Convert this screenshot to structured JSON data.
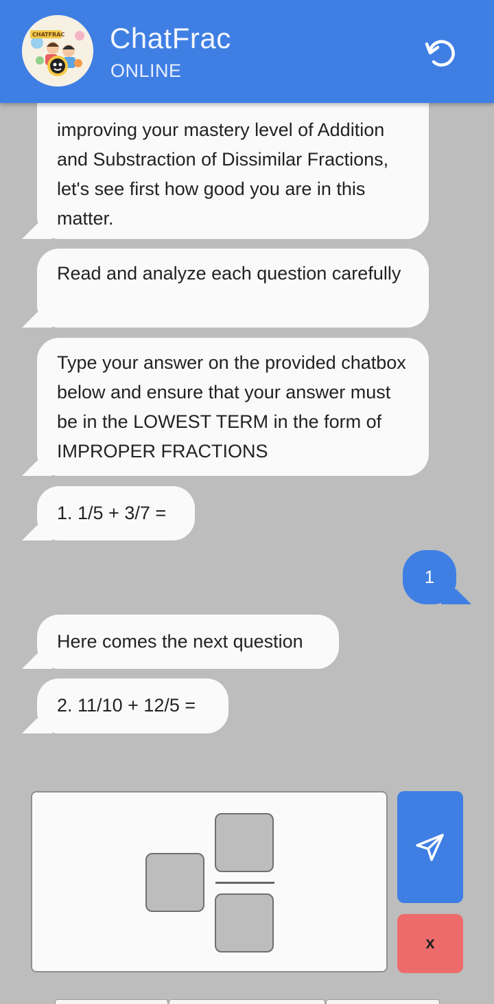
{
  "header": {
    "title": "ChatFrac",
    "status": "ONLINE",
    "logo_text": "CHATFRAC"
  },
  "messages": [
    {
      "sender": "bot",
      "text": "improving your mastery level of Addition and Substraction of Dissimilar Fractions, let's see first how good you are in this matter."
    },
    {
      "sender": "bot",
      "text": "Read and analyze each question carefully"
    },
    {
      "sender": "bot",
      "text": "Type your answer on the provided chatbox below and ensure that your answer must be in the LOWEST TERM in the form of IMPROPER FRACTIONS"
    },
    {
      "sender": "bot",
      "text": "1. 1/5 + 3/7 ="
    },
    {
      "sender": "user",
      "text": "1"
    },
    {
      "sender": "bot",
      "text": "Here comes the next question"
    },
    {
      "sender": "bot",
      "text": "2. 11/10 + 12/5 ="
    }
  ],
  "answer_input": {
    "whole": "",
    "numerator": "",
    "denominator": ""
  },
  "buttons": {
    "send_icon": "send-icon",
    "clear_label": "x"
  },
  "colors": {
    "header": "#3f7fe4",
    "background": "#bdbdbd",
    "bot_bubble": "#fafafa",
    "user_bubble": "#3f7fe4",
    "clear_button": "#ee6b6b"
  }
}
